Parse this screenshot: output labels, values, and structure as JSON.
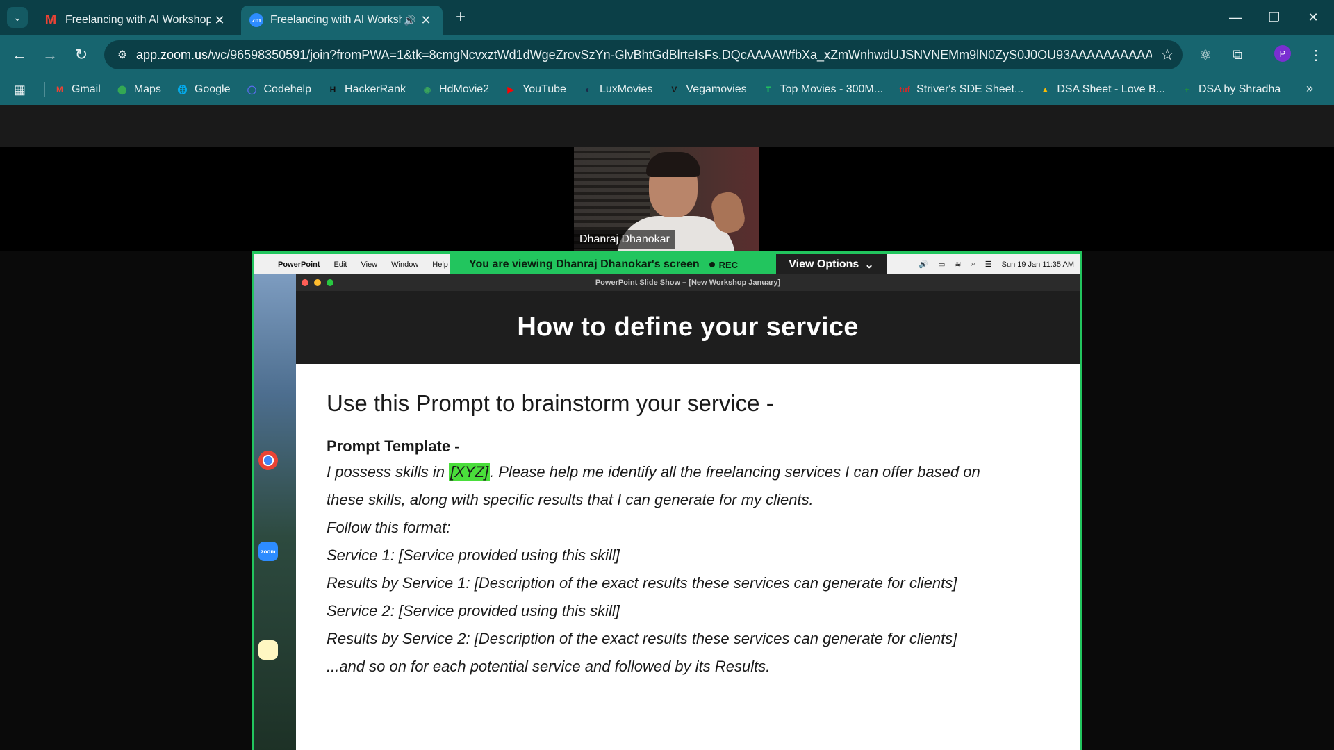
{
  "browser": {
    "tabs": [
      {
        "title": "Freelancing with AI Workshop (",
        "favicon": "gmail-icon",
        "active": false
      },
      {
        "title": "Freelancing with AI Worksh",
        "favicon": "zoom-icon",
        "favicon_text": "zm",
        "active": true
      }
    ],
    "url_host": "app.zoom.us",
    "url_rest": "/wc/96598350591/join?fromPWA=1&tk=8cmgNcvxztWd1dWgeZrovSzYn-GlvBhtGdBlrteIsFs.DQcAAAAWfbXa_xZmWnhwdUJSNVNEMm9lN0ZyS0J0OU93AAAAAAAAAAAAAA...",
    "profile_initial": "P",
    "bookmarks": [
      {
        "label": "Gmail",
        "icon": "gmail-icon",
        "color": "#ea4335",
        "glyph": "M"
      },
      {
        "label": "Maps",
        "icon": "maps-icon",
        "color": "#34a853",
        "glyph": "⬤"
      },
      {
        "label": "Google",
        "icon": "globe-icon",
        "color": "#e8f1f2",
        "glyph": "🌐"
      },
      {
        "label": "Codehelp",
        "icon": "codehelp-icon",
        "color": "#5b6cf0",
        "glyph": "◯"
      },
      {
        "label": "HackerRank",
        "icon": "hackerrank-icon",
        "color": "#111111",
        "glyph": "H"
      },
      {
        "label": "HdMovie2",
        "icon": "hdmovie-icon",
        "color": "#3aa35c",
        "glyph": "◉"
      },
      {
        "label": "YouTube",
        "icon": "youtube-icon",
        "color": "#ff0000",
        "glyph": "▶"
      },
      {
        "label": "LuxMovies",
        "icon": "luxmovies-icon",
        "color": "#1b2a4a",
        "glyph": "◐"
      },
      {
        "label": "Vegamovies",
        "icon": "vegamovies-icon",
        "color": "#1a1a1a",
        "glyph": "V"
      },
      {
        "label": "Top Movies - 300M...",
        "icon": "topmovies-icon",
        "color": "#22c55e",
        "glyph": "T"
      },
      {
        "label": "Striver's SDE Sheet...",
        "icon": "tuf-icon",
        "color": "#d62828",
        "glyph": "tuf"
      },
      {
        "label": "DSA Sheet - Love B...",
        "icon": "drive-icon",
        "color": "#fbbc04",
        "glyph": "▲"
      },
      {
        "label": "DSA by Shradha",
        "icon": "sheets-icon",
        "color": "#1e8e3e",
        "glyph": "+"
      }
    ]
  },
  "zoom": {
    "participant_name": "Dhanraj Dhanokar",
    "share_banner": "You are viewing  Dhanraj Dhanokar's screen",
    "rec_label": "REC",
    "view_options": "View Options",
    "mac_menu": {
      "app": "PowerPoint",
      "items": [
        "Edit",
        "View",
        "Window",
        "Help"
      ],
      "clock": "Sun 19 Jan  11:35 AM"
    },
    "ppt_window_title": "PowerPoint Slide Show – [New Workshop January]",
    "dock": [
      {
        "icon": "chrome-icon",
        "label": ""
      },
      {
        "icon": "zoom-app-icon",
        "label": "zoom"
      },
      {
        "icon": "notes-icon",
        "label": ""
      }
    ]
  },
  "slide": {
    "title": "How to define your service",
    "subtitle": "Use this Prompt to brainstorm your service -",
    "template_label": "Prompt Template -",
    "line1_before": "I possess skills in ",
    "line1_highlight": "[XYZ]",
    "line1_after": ". Please help me identify all the freelancing services I can offer based on",
    "lines": [
      "these skills, along with specific results that I can generate for my clients.",
      "Follow this format:",
      "Service 1: [Service provided using this skill]",
      "Results by Service 1: [Description of the exact results these services can generate for clients]",
      "Service 2: [Service provided using this skill]",
      "Results by Service 2: [Description of the exact results these services can generate for clients]",
      "...and so on for each potential service and followed by its Results."
    ]
  }
}
